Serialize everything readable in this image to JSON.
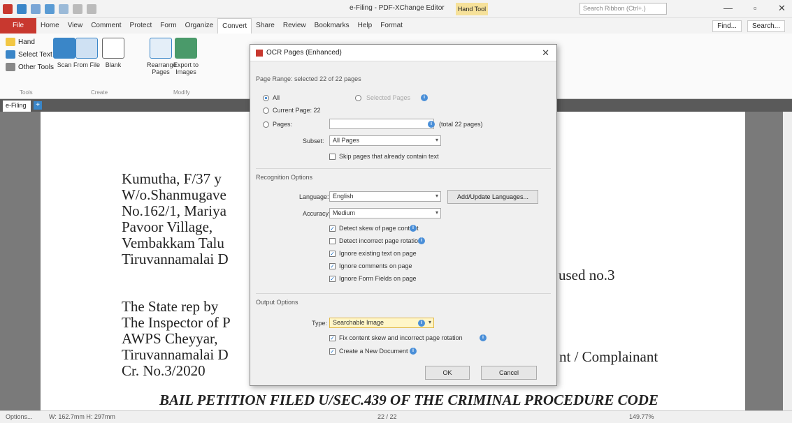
{
  "window": {
    "title": "e-Filing - PDF-XChange Editor",
    "context_tab": "Hand Tool",
    "search_placeholder": "Search Ribbon (Ctrl+.)"
  },
  "menu": {
    "file": "File",
    "items": [
      "Home",
      "View",
      "Comment",
      "Protect",
      "Form",
      "Organize",
      "Convert",
      "Share",
      "Review",
      "Bookmarks",
      "Help",
      "Format"
    ],
    "active_index": 6,
    "find": "Find...",
    "search": "Search..."
  },
  "ribbon": {
    "hand": "Hand",
    "select_text": "Select Text",
    "other_tools": "Other Tools",
    "tools_group": "Tools",
    "scan": "Scan",
    "from_file": "From File",
    "blank": "Blank",
    "create_group": "Create",
    "rearrange": "Rearrange Pages",
    "export_images": "Export to Images",
    "modify_group": "Modify"
  },
  "tabs": {
    "doc": "e-Filing",
    "new": "+"
  },
  "document": {
    "address": [
      "Kumutha, F/37 y",
      "W/o.Shanmugave",
      "No.162/1, Mariya",
      "Pavoor Village,",
      "Vembakkam Talu",
      "Tiruvannamalai D"
    ],
    "accused": "used no.3",
    "respondent": [
      "The State rep by",
      "The Inspector of P",
      "AWPS Cheyyar,",
      "Tiruvannamalai D",
      "Cr. No.3/2020"
    ],
    "complainant": "nt / Complainant",
    "heading": "BAIL PETITION FILED U/SEC.439 OF THE CRIMINAL PROCEDURE CODE"
  },
  "dialog": {
    "title": "OCR Pages (Enhanced)",
    "page_range_label": "Page Range: selected 22 of 22 pages",
    "all": "All",
    "all_selected": true,
    "selected_pages": "Selected Pages",
    "current_page": "Current Page: 22",
    "pages": "Pages:",
    "pages_hint": "(total 22 pages)",
    "subset_label": "Subset:",
    "subset_value": "All Pages",
    "skip_label": "Skip pages that already contain text",
    "skip_checked": false,
    "recognition_label": "Recognition Options",
    "language_label": "Language:",
    "language_value": "English",
    "add_languages": "Add/Update Languages...",
    "accuracy_label": "Accuracy:",
    "accuracy_value": "Medium",
    "options": [
      {
        "label": "Detect skew of page content",
        "checked": true,
        "info": true
      },
      {
        "label": "Detect incorrect page rotation",
        "checked": false,
        "info": true
      },
      {
        "label": "Ignore existing text on page",
        "checked": true,
        "info": false
      },
      {
        "label": "Ignore comments on page",
        "checked": true,
        "info": false
      },
      {
        "label": "Ignore Form Fields on page",
        "checked": true,
        "info": false
      }
    ],
    "output_label": "Output Options",
    "type_label": "Type:",
    "type_value": "Searchable Image",
    "output_options": [
      {
        "label": "Fix content skew and incorrect page rotation",
        "checked": true
      },
      {
        "label": "Create a New Document",
        "checked": true
      }
    ],
    "ok": "OK",
    "cancel": "Cancel"
  },
  "status": {
    "options": "Options...",
    "size": "W: 162.7mm H: 297mm",
    "page": "22 / 22",
    "zoom": "149.77%"
  },
  "colors": {
    "accent": "#c8382f",
    "ribbon_blue": "#3a86c8"
  }
}
